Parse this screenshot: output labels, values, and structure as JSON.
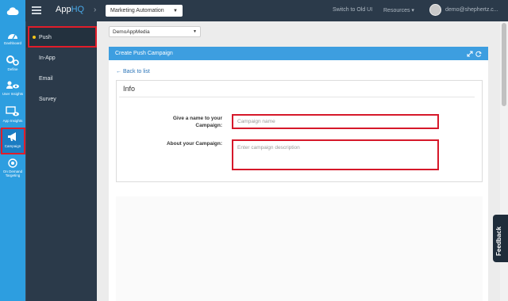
{
  "topbar": {
    "brand_prefix": "App",
    "brand_suffix": "HQ",
    "app_name": "Marketing Automation",
    "switch_link": "Switch to Old UI",
    "resources": "Resources",
    "user": "demo@shephertz.c..."
  },
  "rail": [
    {
      "label": "Dashboard",
      "icon": "dashboard-icon"
    },
    {
      "label": "Define",
      "icon": "gears-icon"
    },
    {
      "label": "User Insights",
      "icon": "users-eye-icon"
    },
    {
      "label": "App Insights",
      "icon": "monitor-eye-icon"
    },
    {
      "label": "Campaign",
      "icon": "megaphone-icon"
    },
    {
      "label": "On Demand Targeting",
      "icon": "target-icon"
    }
  ],
  "subnav": [
    "Push",
    "In-App",
    "Email",
    "Survey"
  ],
  "main": {
    "media_select": "DemoAppMedia",
    "panel_title": "Create Push Campaign",
    "back_link": "Back to list",
    "info_title": "Info",
    "name_label": "Give a name to your Campaign:",
    "name_placeholder": "Campaign name",
    "about_label": "About your Campaign:",
    "about_placeholder": "Enter campaign description"
  },
  "feedback": "Feedback",
  "colors": {
    "accent": "#2d9ee0",
    "dark": "#2b3a4a",
    "highlight": "#e11d2a"
  }
}
